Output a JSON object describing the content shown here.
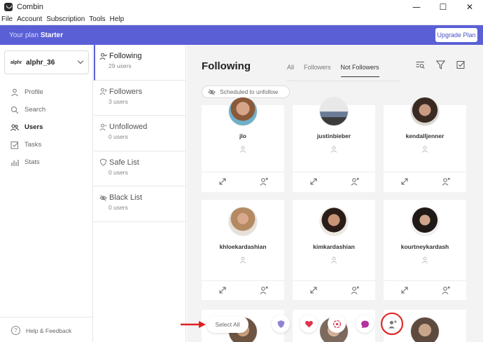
{
  "window": {
    "title": "Combin",
    "minimize": "—",
    "maximize": "☐",
    "close": "✕"
  },
  "menu": [
    "File",
    "Account",
    "Subscription",
    "Tools",
    "Help"
  ],
  "plan": {
    "label": "Your plan",
    "name": "Starter",
    "upgrade": "Upgrade Plan"
  },
  "account": {
    "logo": "alphr",
    "name": "alphr_36"
  },
  "nav": [
    {
      "label": "Profile",
      "icon": "person-icon"
    },
    {
      "label": "Search",
      "icon": "search-icon"
    },
    {
      "label": "Users",
      "icon": "users-icon"
    },
    {
      "label": "Tasks",
      "icon": "tasks-icon"
    },
    {
      "label": "Stats",
      "icon": "stats-icon"
    }
  ],
  "help": {
    "label": "Help & Feedback",
    "icon_glyph": "?"
  },
  "categories": [
    {
      "title": "Following",
      "count": "29 users"
    },
    {
      "title": "Followers",
      "count": "3 users"
    },
    {
      "title": "Unfollowed",
      "count": "0 users"
    },
    {
      "title": "Safe List",
      "count": "0 users"
    },
    {
      "title": "Black List",
      "count": "0 users"
    }
  ],
  "main": {
    "title": "Following",
    "tabs": [
      "All",
      "Followers",
      "Not Followers"
    ],
    "active_tab": "Not Followers",
    "chip": "Scheduled to unfollow"
  },
  "users": [
    "jlo",
    "justinbieber",
    "kendalljenner",
    "khloekardashian",
    "kimkardashian",
    "kourtneykardash"
  ],
  "bottom": {
    "select_all": "Select All"
  },
  "colors": {
    "accent": "#5a5fd6",
    "heart": "#e0334f",
    "comment": "#b0329b",
    "highlight": "#e02020",
    "shield": "#8e83d6"
  }
}
